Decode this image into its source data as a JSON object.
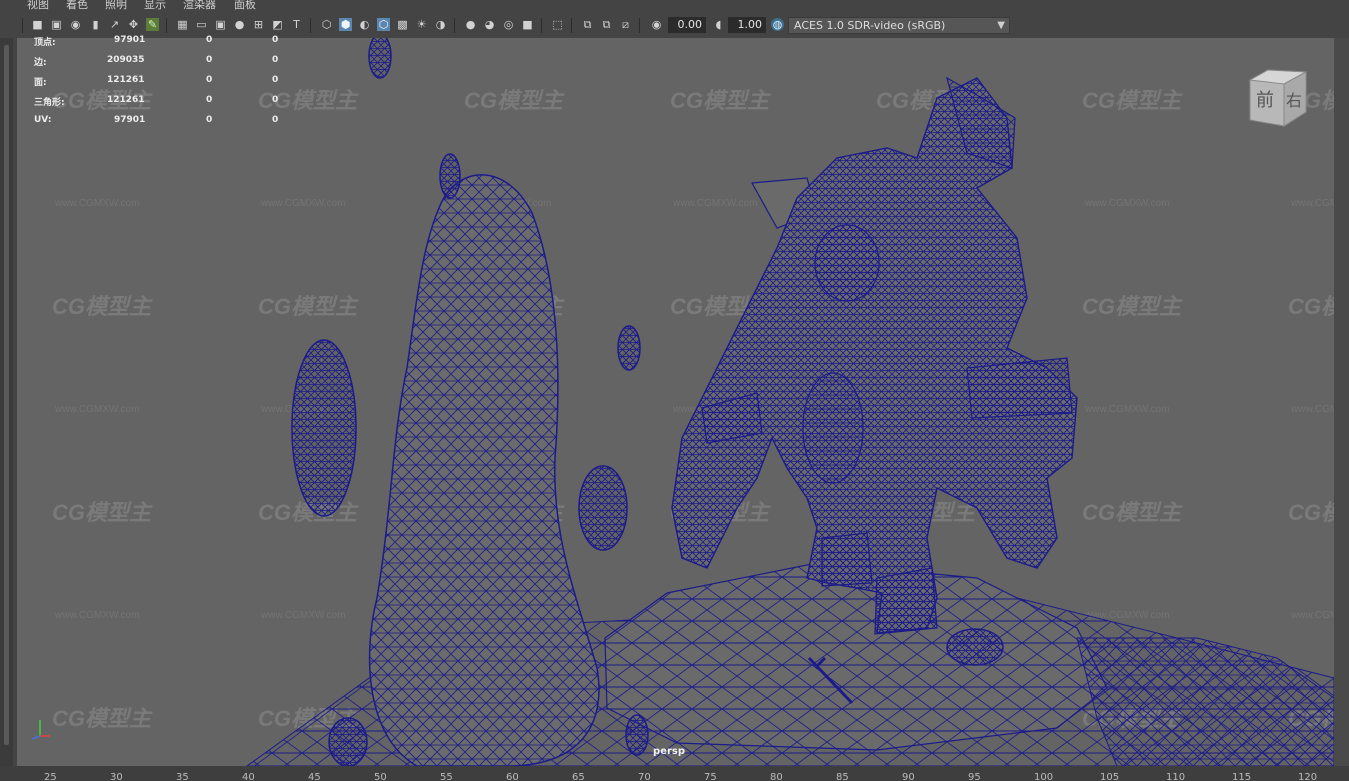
{
  "menu": [
    "视图",
    "着色",
    "照明",
    "显示",
    "渲染器",
    "面板"
  ],
  "toolbar": {
    "exposure_value": "0.00",
    "gamma_value": "1.00",
    "color_management": "ACES 1.0 SDR-video (sRGB)"
  },
  "hud": [
    {
      "label": "顶点:",
      "total": "97901",
      "selected": "0",
      "other": "0"
    },
    {
      "label": "边:",
      "total": "209035",
      "selected": "0",
      "other": "0"
    },
    {
      "label": "面:",
      "total": "121261",
      "selected": "0",
      "other": "0"
    },
    {
      "label": "三角形:",
      "total": "121261",
      "selected": "0",
      "other": "0"
    },
    {
      "label": "UV:",
      "total": "97901",
      "selected": "0",
      "other": "0"
    }
  ],
  "viewcube": {
    "front": "前",
    "right": "右"
  },
  "camera_label": "persp",
  "timeline_ticks": [
    "25",
    "30",
    "35",
    "40",
    "45",
    "50",
    "55",
    "60",
    "65",
    "70",
    "75",
    "80",
    "85",
    "90",
    "95",
    "100",
    "105",
    "110",
    "115",
    "120"
  ],
  "watermark": {
    "logo": "CG模型主",
    "url": "www.CGMXW.com"
  },
  "colors": {
    "viewport_bg": "#646464",
    "wireframe": "#1b1b8a",
    "ui_bg": "#444444"
  }
}
